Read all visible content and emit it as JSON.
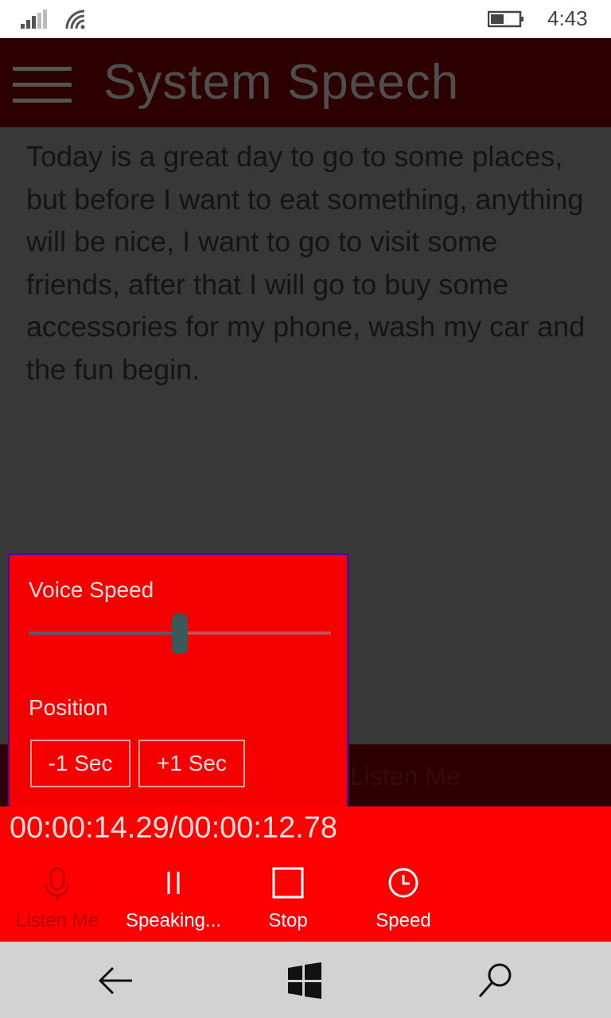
{
  "status": {
    "time": "4:43"
  },
  "app": {
    "title": "System Speech"
  },
  "content": {
    "text": "Today is a great day to go to some places, but before I want to eat something, anything will be nice, I want to go to visit some friends, after that I will go to buy some accessories for my phone, wash my car and the fun begin.",
    "obscured_text": "Listen Me"
  },
  "flyout": {
    "voice_speed_label": "Voice Speed",
    "voice_speed_value": 0.5,
    "position_label": "Position",
    "minus_label": "-1 Sec",
    "plus_label": "+1 Sec"
  },
  "player": {
    "timecode": "00:00:14.29/00:00:12.78"
  },
  "commands": {
    "listen": "Listen Me",
    "speaking": "Speaking...",
    "stop": "Stop",
    "speed": "Speed"
  },
  "colors": {
    "accent": "#ff0000",
    "appbar": "#2d0000",
    "flyout": "#f50000"
  }
}
